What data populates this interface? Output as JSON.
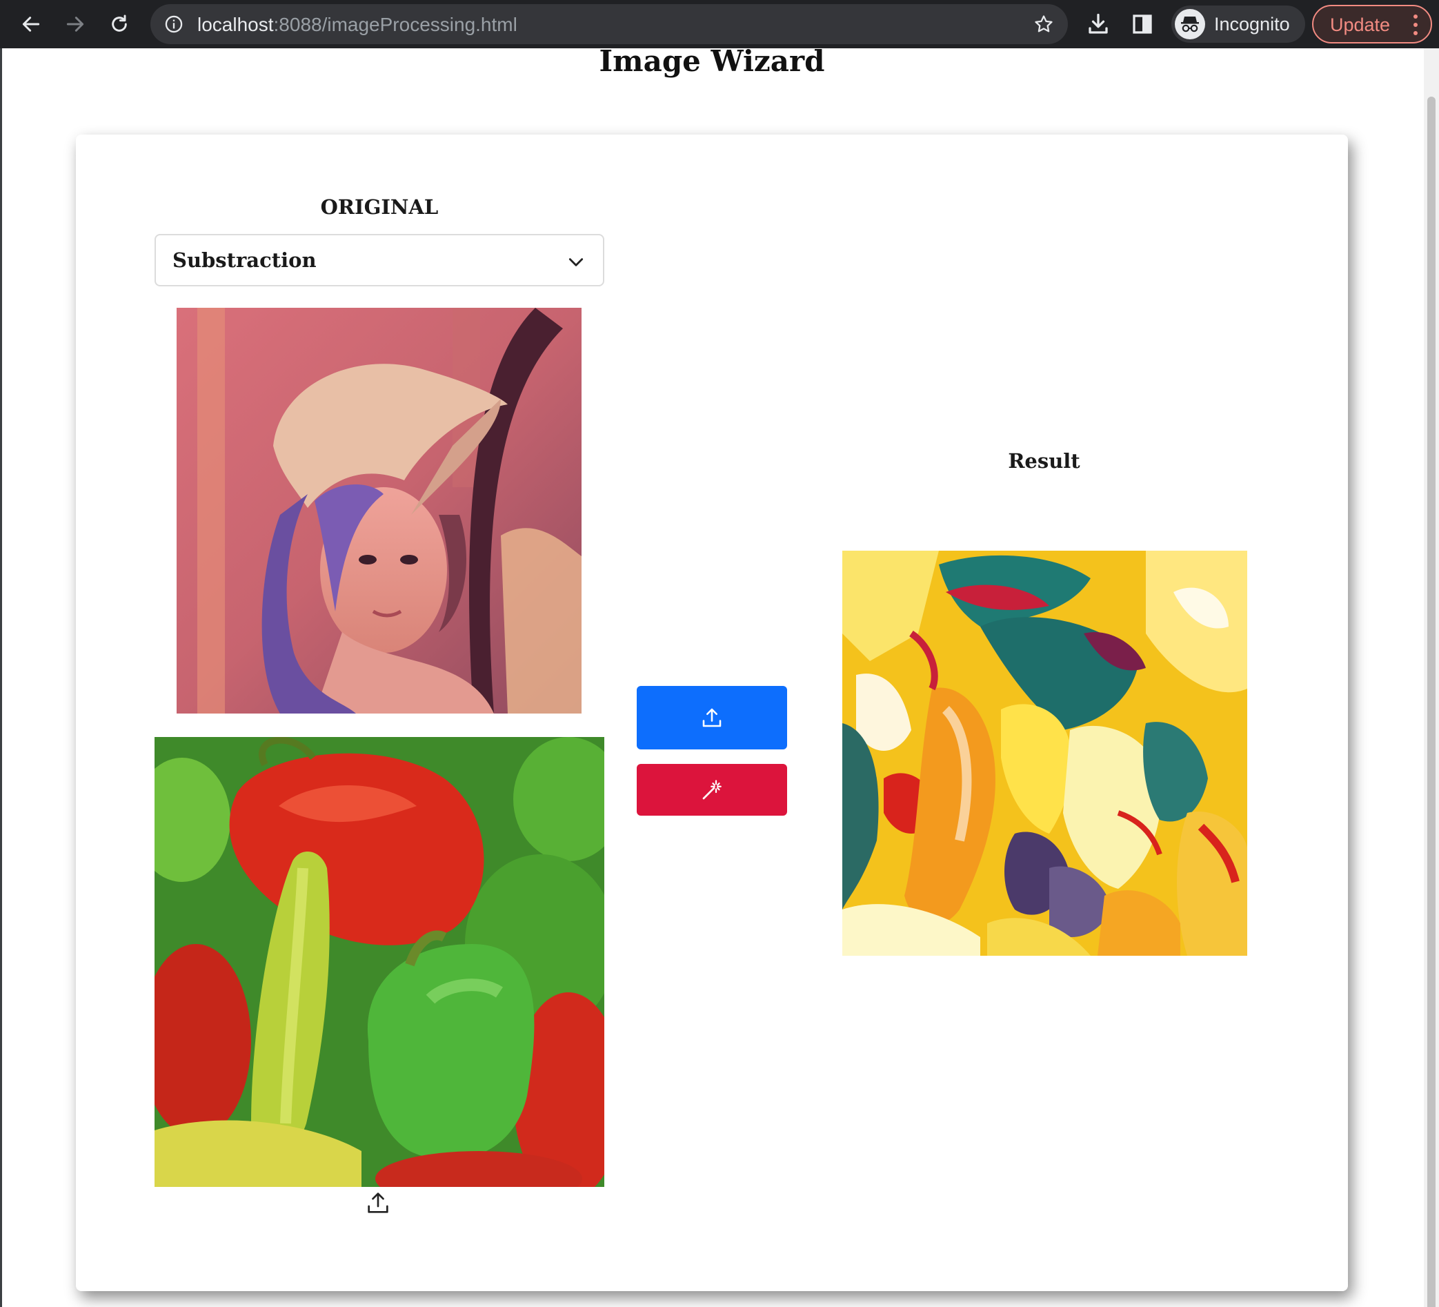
{
  "browser": {
    "url_host": "localhost",
    "url_rest": ":8088/imageProcessing.html",
    "profile_label": "Incognito",
    "update_label": "Update",
    "icons": [
      "back-icon",
      "forward-icon",
      "reload-icon",
      "info-icon",
      "star-icon",
      "download-icon",
      "side-panel-icon",
      "incognito-icon",
      "more-icon"
    ]
  },
  "page": {
    "title": "Image Wizard"
  },
  "original": {
    "label": "ORIGINAL",
    "operation_selected": "Substraction"
  },
  "result": {
    "label": "Result"
  },
  "actions": {
    "upload_icon": "upload-icon",
    "magic_icon": "magic-wand-icon"
  },
  "colors": {
    "upload_button": "#0d6efd",
    "magic_button": "#dc143c"
  }
}
